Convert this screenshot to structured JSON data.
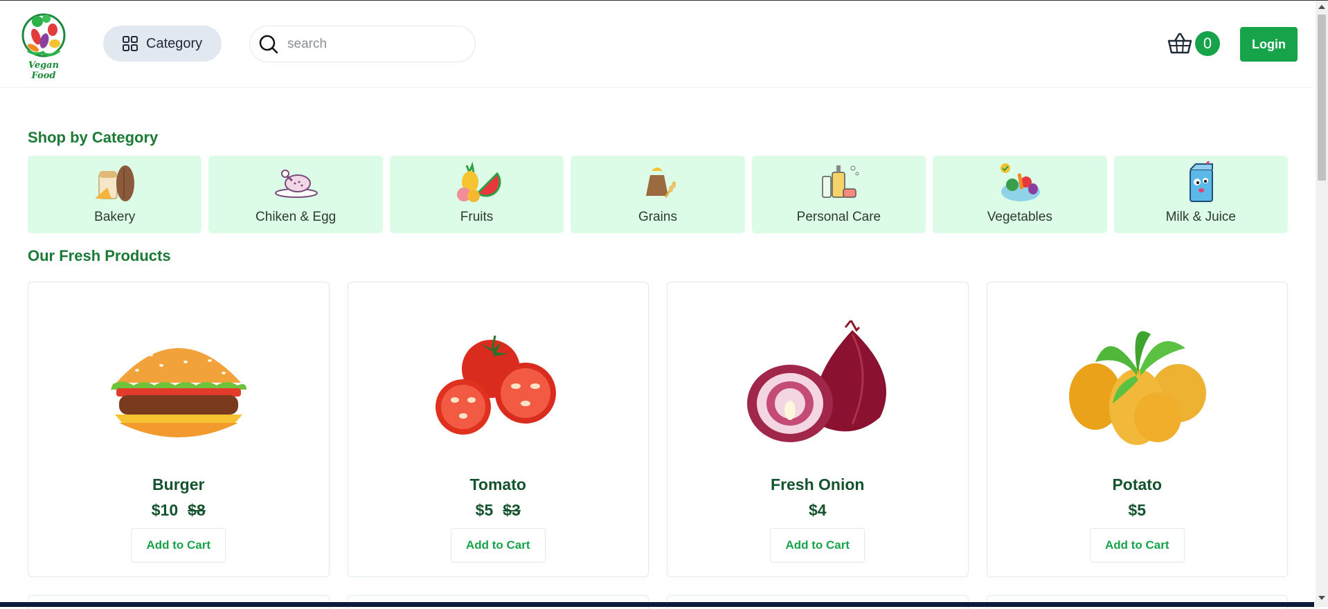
{
  "header": {
    "logo_text": "Vegan Food",
    "category_label": "Category",
    "search_placeholder": "search",
    "cart_count": "0",
    "login_label": "Login"
  },
  "categories_section": {
    "title": "Shop by Category",
    "items": [
      {
        "label": "Bakery",
        "icon": "bread-icon"
      },
      {
        "label": "Chiken & Egg",
        "icon": "chicken-icon"
      },
      {
        "label": "Fruits",
        "icon": "fruits-icon"
      },
      {
        "label": "Grains",
        "icon": "grains-icon"
      },
      {
        "label": "Personal Care",
        "icon": "personal-care-icon"
      },
      {
        "label": "Vegetables",
        "icon": "vegetables-icon"
      },
      {
        "label": "Milk & Juice",
        "icon": "juice-box-icon"
      }
    ]
  },
  "products_section": {
    "title": "Our Fresh Products",
    "add_label": "Add to Cart",
    "items": [
      {
        "name": "Burger",
        "price": "$10",
        "old_price": "$8",
        "image": "burger-image"
      },
      {
        "name": "Tomato",
        "price": "$5",
        "old_price": "$3",
        "image": "tomato-image"
      },
      {
        "name": "Fresh Onion",
        "price": "$4",
        "old_price": "",
        "image": "onion-image"
      },
      {
        "name": "Potato",
        "price": "$5",
        "old_price": "",
        "image": "potato-image"
      }
    ]
  },
  "colors": {
    "accent": "#16a34a",
    "heading": "#1a7a36",
    "category_bg": "#dcfce7",
    "category_button_bg": "#e2e8f0"
  }
}
